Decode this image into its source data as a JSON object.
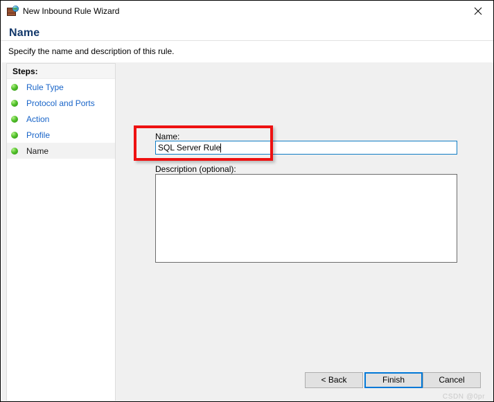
{
  "window": {
    "title": "New Inbound Rule Wizard",
    "icon": "firewall-globe-icon",
    "close_label": "✕"
  },
  "header": {
    "title": "Name",
    "subtitle": "Specify the name and description of this rule."
  },
  "sidebar": {
    "heading": "Steps:",
    "items": [
      {
        "label": "Rule Type",
        "current": false
      },
      {
        "label": "Protocol and Ports",
        "current": false
      },
      {
        "label": "Action",
        "current": false
      },
      {
        "label": "Profile",
        "current": false
      },
      {
        "label": "Name",
        "current": true
      }
    ]
  },
  "form": {
    "name_label": "Name:",
    "name_value": "SQL Server Rule",
    "name_placeholder": "",
    "description_label": "Description (optional):",
    "description_value": "",
    "description_placeholder": ""
  },
  "buttons": {
    "back": "< Back",
    "finish": "Finish",
    "cancel": "Cancel"
  },
  "watermark": "CSDN @0pr",
  "colors": {
    "accent": "#0078d7",
    "header_title": "#14396b",
    "link": "#1864c8",
    "annotation": "#ee1111",
    "body_bg": "#f0f0f0",
    "step_bullet": "#52c22b"
  }
}
